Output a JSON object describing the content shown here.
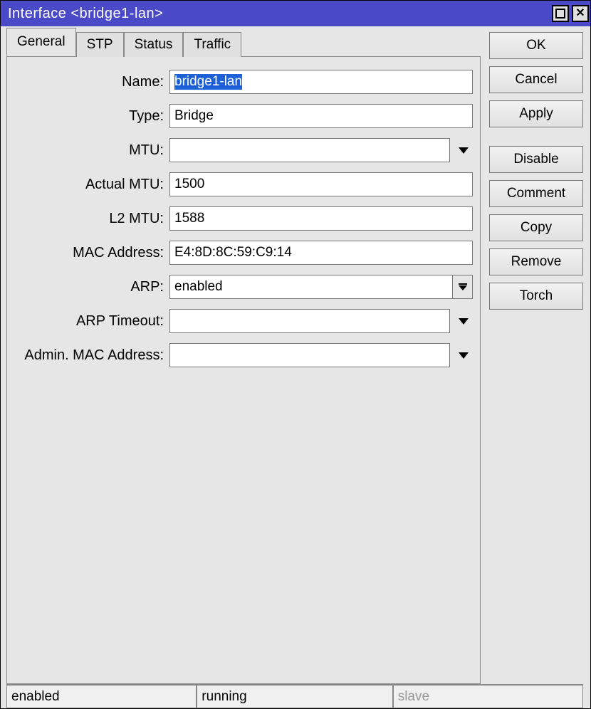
{
  "window": {
    "title": "Interface <bridge1-lan>"
  },
  "tabs": [
    {
      "label": "General",
      "active": true
    },
    {
      "label": "STP",
      "active": false
    },
    {
      "label": "Status",
      "active": false
    },
    {
      "label": "Traffic",
      "active": false
    }
  ],
  "fields": {
    "name": {
      "label": "Name:",
      "value": "bridge1-lan",
      "selected": true
    },
    "type": {
      "label": "Type:",
      "value": "Bridge"
    },
    "mtu": {
      "label": "MTU:",
      "value": ""
    },
    "actual_mtu": {
      "label": "Actual MTU:",
      "value": "1500"
    },
    "l2_mtu": {
      "label": "L2 MTU:",
      "value": "1588"
    },
    "mac_address": {
      "label": "MAC Address:",
      "value": "E4:8D:8C:59:C9:14"
    },
    "arp": {
      "label": "ARP:",
      "value": "enabled"
    },
    "arp_timeout": {
      "label": "ARP Timeout:",
      "value": ""
    },
    "admin_mac": {
      "label": "Admin. MAC Address:",
      "value": ""
    }
  },
  "buttons": {
    "ok": "OK",
    "cancel": "Cancel",
    "apply": "Apply",
    "disable": "Disable",
    "comment": "Comment",
    "copy": "Copy",
    "remove": "Remove",
    "torch": "Torch"
  },
  "status": {
    "cell1": "enabled",
    "cell2": "running",
    "cell3": "slave"
  }
}
